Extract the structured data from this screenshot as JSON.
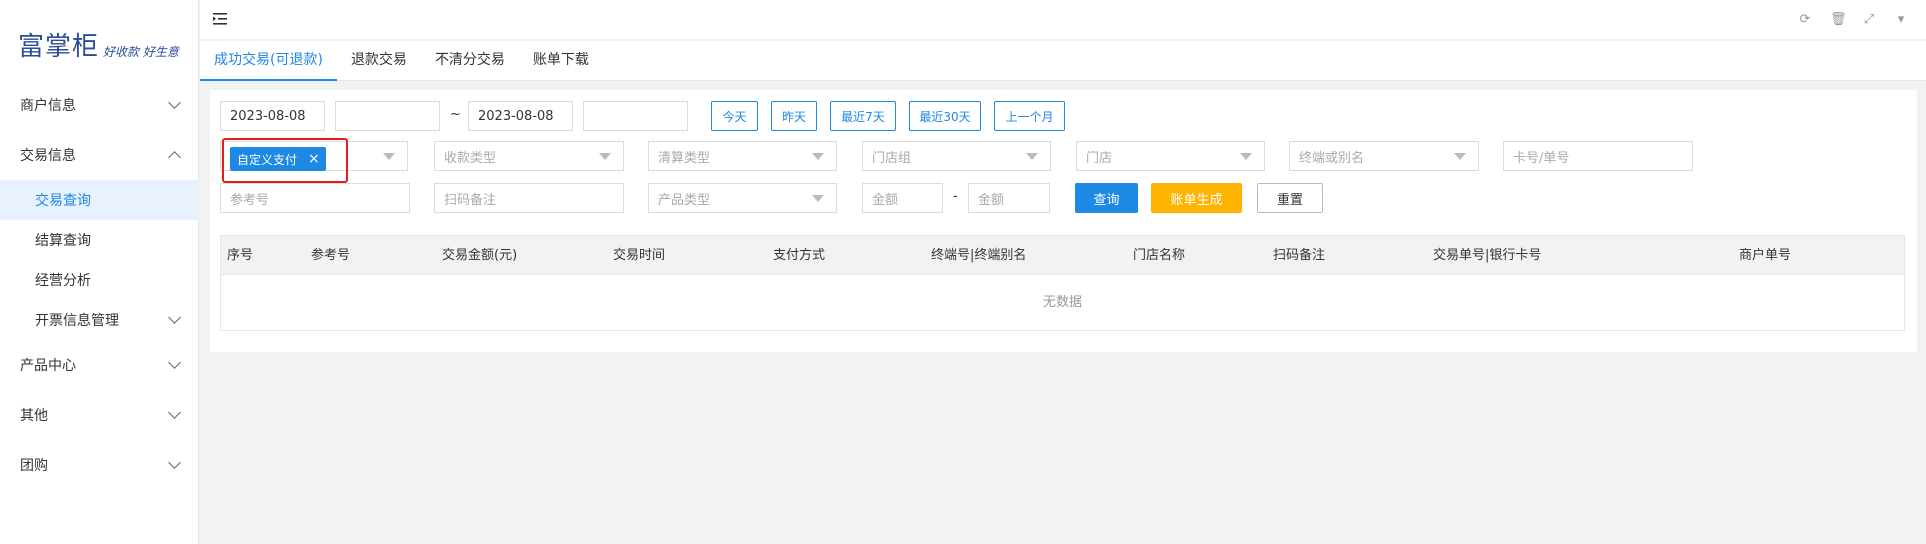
{
  "logo": {
    "main": "富掌柜",
    "slogan": "好收款 好生意"
  },
  "sidebar": {
    "items": [
      {
        "label": "商户信息"
      },
      {
        "label": "交易信息"
      },
      {
        "label": "产品中心"
      },
      {
        "label": "其他"
      },
      {
        "label": "团购"
      }
    ],
    "sub_items": [
      {
        "label": "交易查询"
      },
      {
        "label": "结算查询"
      },
      {
        "label": "经营分析"
      },
      {
        "label": "开票信息管理"
      }
    ]
  },
  "tabs": [
    {
      "label": "成功交易(可退款)"
    },
    {
      "label": "退款交易"
    },
    {
      "label": "不清分交易"
    },
    {
      "label": "账单下载"
    }
  ],
  "filters": {
    "start_date": "2023-08-08",
    "end_date": "2023-08-08",
    "range_sep": "~",
    "quick": [
      "今天",
      "昨天",
      "最近7天",
      "最近30天",
      "上一个月"
    ],
    "payment_tag": "自定义支付",
    "payment_tag_close": "×",
    "collect_type": "收款类型",
    "settle_type": "清算类型",
    "store_group": "门店组",
    "store": "门店",
    "terminal": "终端或别名",
    "card_no": "卡号/单号",
    "ref_no": "参考号",
    "scan_note": "扫码备注",
    "product_type": "产品类型",
    "amount_min": "金额",
    "amount_sep": "-",
    "amount_max": "金额",
    "query_btn": "查询",
    "bill_btn": "账单生成",
    "reset_btn": "重置"
  },
  "table": {
    "columns": [
      "序号",
      "参考号",
      "交易金额(元)",
      "交易时间",
      "支付方式",
      "终端号|终端别名",
      "门店名称",
      "扫码备注",
      "交易单号|银行卡号",
      "商户单号"
    ],
    "empty": "无数据"
  },
  "icons": {
    "refresh": "refresh-icon",
    "delete": "trash-icon",
    "fullscreen": "fullscreen-icon",
    "dropdown": "caret-down-icon"
  },
  "colors": {
    "accent": "#1e88e5",
    "warn": "#ffb400",
    "highlight": "#e02020"
  }
}
